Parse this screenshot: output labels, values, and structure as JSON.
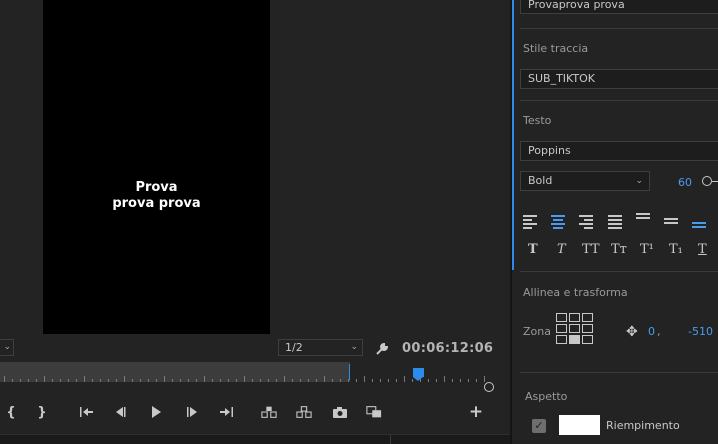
{
  "monitor": {
    "caption_line1": "Prova",
    "caption_line2": "prova prova",
    "resolution": "1/2",
    "timecode": "00:06:12:06",
    "ruler_ticks": 61
  },
  "transport": {
    "mark_in": "{",
    "mark_out": "}",
    "add": "+"
  },
  "panel": {
    "text_value": "Provaprova prova",
    "track_style_label": "Stile traccia",
    "track_style_value": "SUB_TIKTOK",
    "text_label": "Testo",
    "font_value": "Poppins",
    "weight_value": "Bold",
    "font_size": "60",
    "type_styles": [
      "T",
      "T",
      "TT",
      "Tт",
      "T¹",
      "T₁",
      "T"
    ],
    "align_section_label": "Allinea e trasforma",
    "zone_label": "Zona",
    "pos_x": "0",
    "pos_sep": ",",
    "pos_y": "-510",
    "appearance_label": "Aspetto",
    "fill_label": "Riempimento",
    "fill_color": "#ffffff",
    "accent_color": "#2d8ceb"
  }
}
